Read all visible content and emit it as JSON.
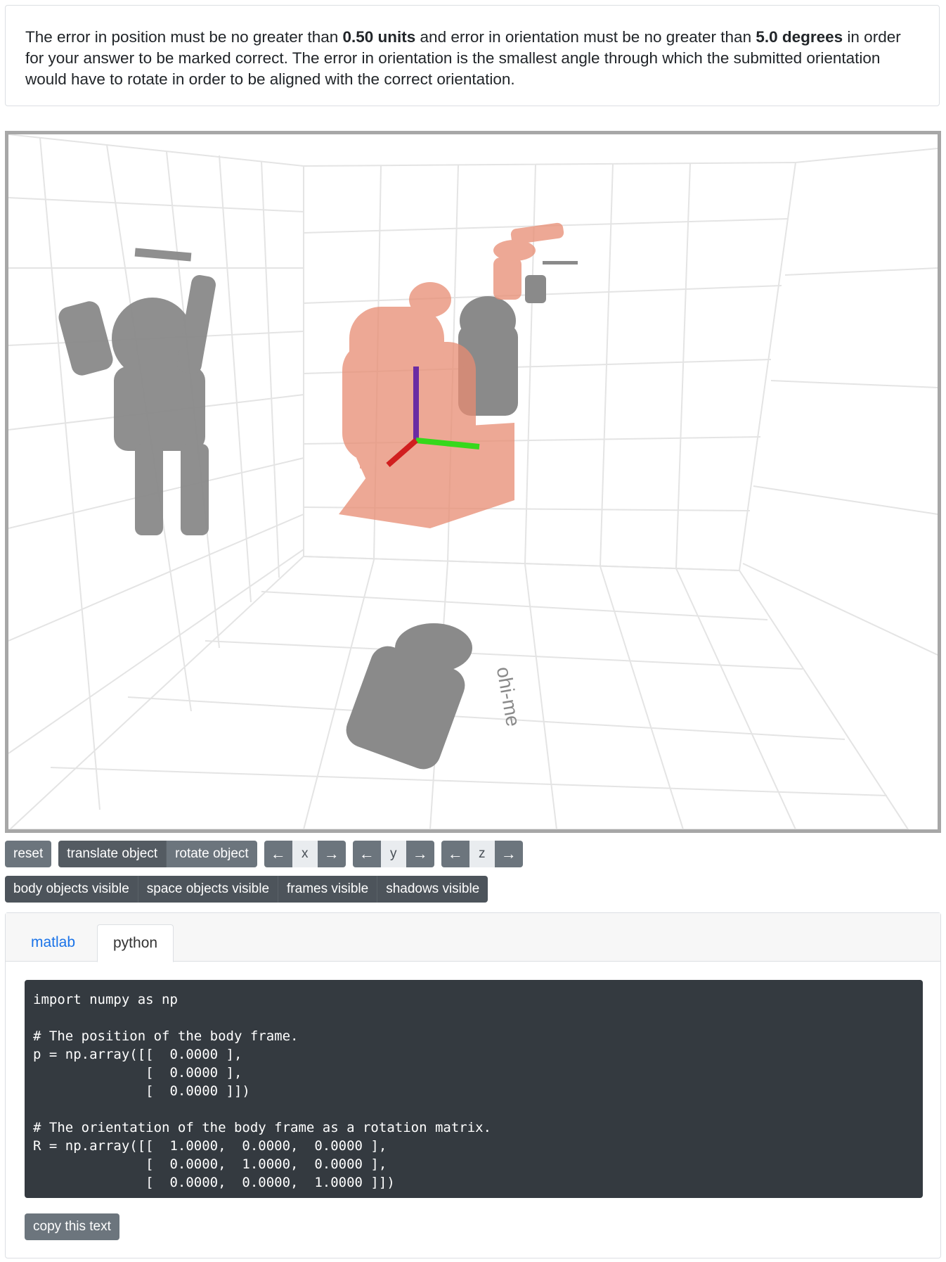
{
  "info": {
    "part1": "The error in position must be no greater than ",
    "pos_threshold": "0.50 units",
    "part2": " and error in orientation must be no greater than ",
    "ori_threshold": "5.0 degrees",
    "part3": " in order for your answer to be marked correct. The error in orientation is the smallest angle through which the submitted orientation would have to rotate in order to be aligned with the correct orientation."
  },
  "viewer": {
    "floor_text": "ohi-me",
    "colors": {
      "object": "#e88c72",
      "shadow": "#8a8a8a",
      "grid": "#e4e4e4",
      "x_axis": "#d11f1f",
      "y_axis": "#36d81c",
      "z_axis": "#6a2ca3"
    }
  },
  "controls": {
    "reset": "reset",
    "translate": "translate object",
    "rotate": "rotate object",
    "left_arrow": "←",
    "right_arrow": "→",
    "axis_x": "x",
    "axis_y": "y",
    "axis_z": "z",
    "body_visible": "body objects visible",
    "space_visible": "space objects visible",
    "frames_visible": "frames visible",
    "shadows_visible": "shadows visible"
  },
  "code_panel": {
    "tabs": [
      {
        "label": "matlab"
      },
      {
        "label": "python"
      }
    ],
    "active_tab": "python",
    "code": "import numpy as np\n\n# The position of the body frame.\np = np.array([[  0.0000 ],\n              [  0.0000 ],\n              [  0.0000 ]])\n\n# The orientation of the body frame as a rotation matrix.\nR = np.array([[  1.0000,  0.0000,  0.0000 ],\n              [  0.0000,  1.0000,  0.0000 ],\n              [  0.0000,  0.0000,  1.0000 ]])",
    "copy_label": "copy this text"
  }
}
